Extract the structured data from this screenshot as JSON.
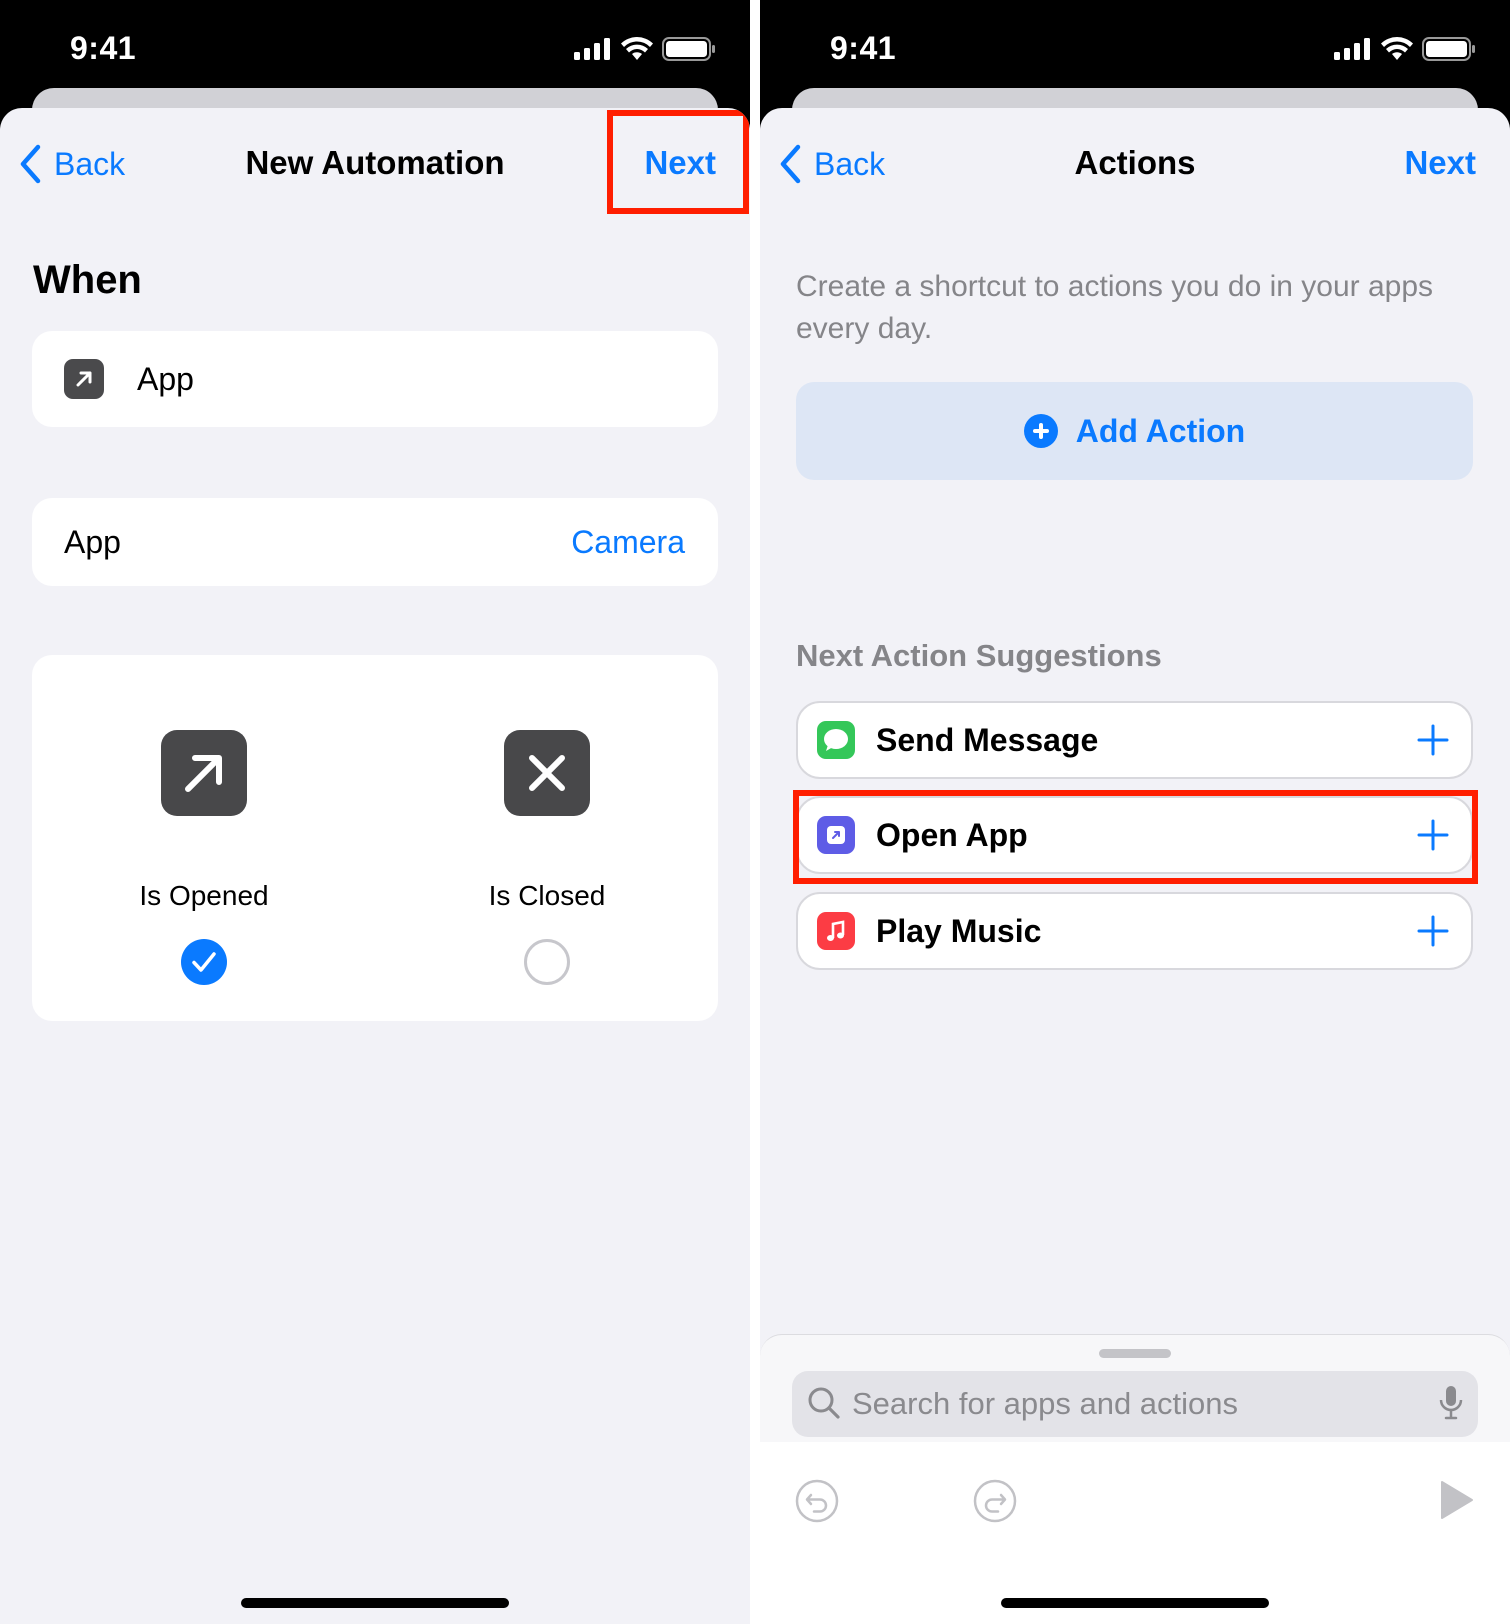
{
  "left_screen": {
    "status": {
      "time": "9:41"
    },
    "nav": {
      "back_label": "Back",
      "title": "New Automation",
      "next_label": "Next"
    },
    "section_title": "When",
    "trigger": {
      "label": "App",
      "icon": "app-arrow-icon"
    },
    "app_row": {
      "label": "App",
      "value": "Camera"
    },
    "states": [
      {
        "label": "Is Opened",
        "icon": "arrow-up-right-icon",
        "selected": true
      },
      {
        "label": "Is Closed",
        "icon": "xmark-icon",
        "selected": false
      }
    ]
  },
  "right_screen": {
    "status": {
      "time": "9:41"
    },
    "nav": {
      "back_label": "Back",
      "title": "Actions",
      "next_label": "Next"
    },
    "description": "Create a shortcut to actions you do in your apps every day.",
    "add_action_label": "Add Action",
    "suggestions_title": "Next Action Suggestions",
    "suggestions": [
      {
        "label": "Send Message",
        "icon": "messages-icon",
        "color": "#34c759"
      },
      {
        "label": "Open App",
        "icon": "open-app-icon",
        "color": "#5e5ce6"
      },
      {
        "label": "Play Music",
        "icon": "music-icon",
        "color": "#fc3c44"
      }
    ],
    "search": {
      "placeholder": "Search for apps and actions"
    }
  },
  "colors": {
    "accent": "#0a7aff",
    "highlight": "#ff1e00",
    "background": "#f2f2f7"
  }
}
